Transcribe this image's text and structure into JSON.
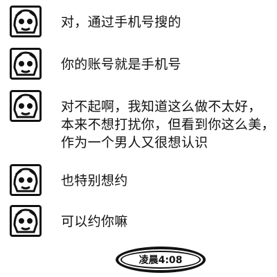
{
  "messages": [
    {
      "lines": [
        "对，通过手机号搜的"
      ],
      "avatar_icon": "cartoon-avatar-icon"
    },
    {
      "lines": [
        "你的账号就是手机号"
      ],
      "avatar_icon": "cartoon-avatar-icon"
    },
    {
      "lines": [
        "对不起啊，我知道这么做不太好，",
        "本来不想打扰你，但看到你这么美，",
        "作为一个男人又很想认识"
      ],
      "avatar_icon": "cartoon-avatar-icon"
    },
    {
      "lines": [
        "也特别想约"
      ],
      "avatar_icon": "cartoon-avatar-icon"
    },
    {
      "lines": [
        "可以约你嘛"
      ],
      "avatar_icon": "cartoon-avatar-icon"
    }
  ],
  "timestamp": "凌晨4:08"
}
